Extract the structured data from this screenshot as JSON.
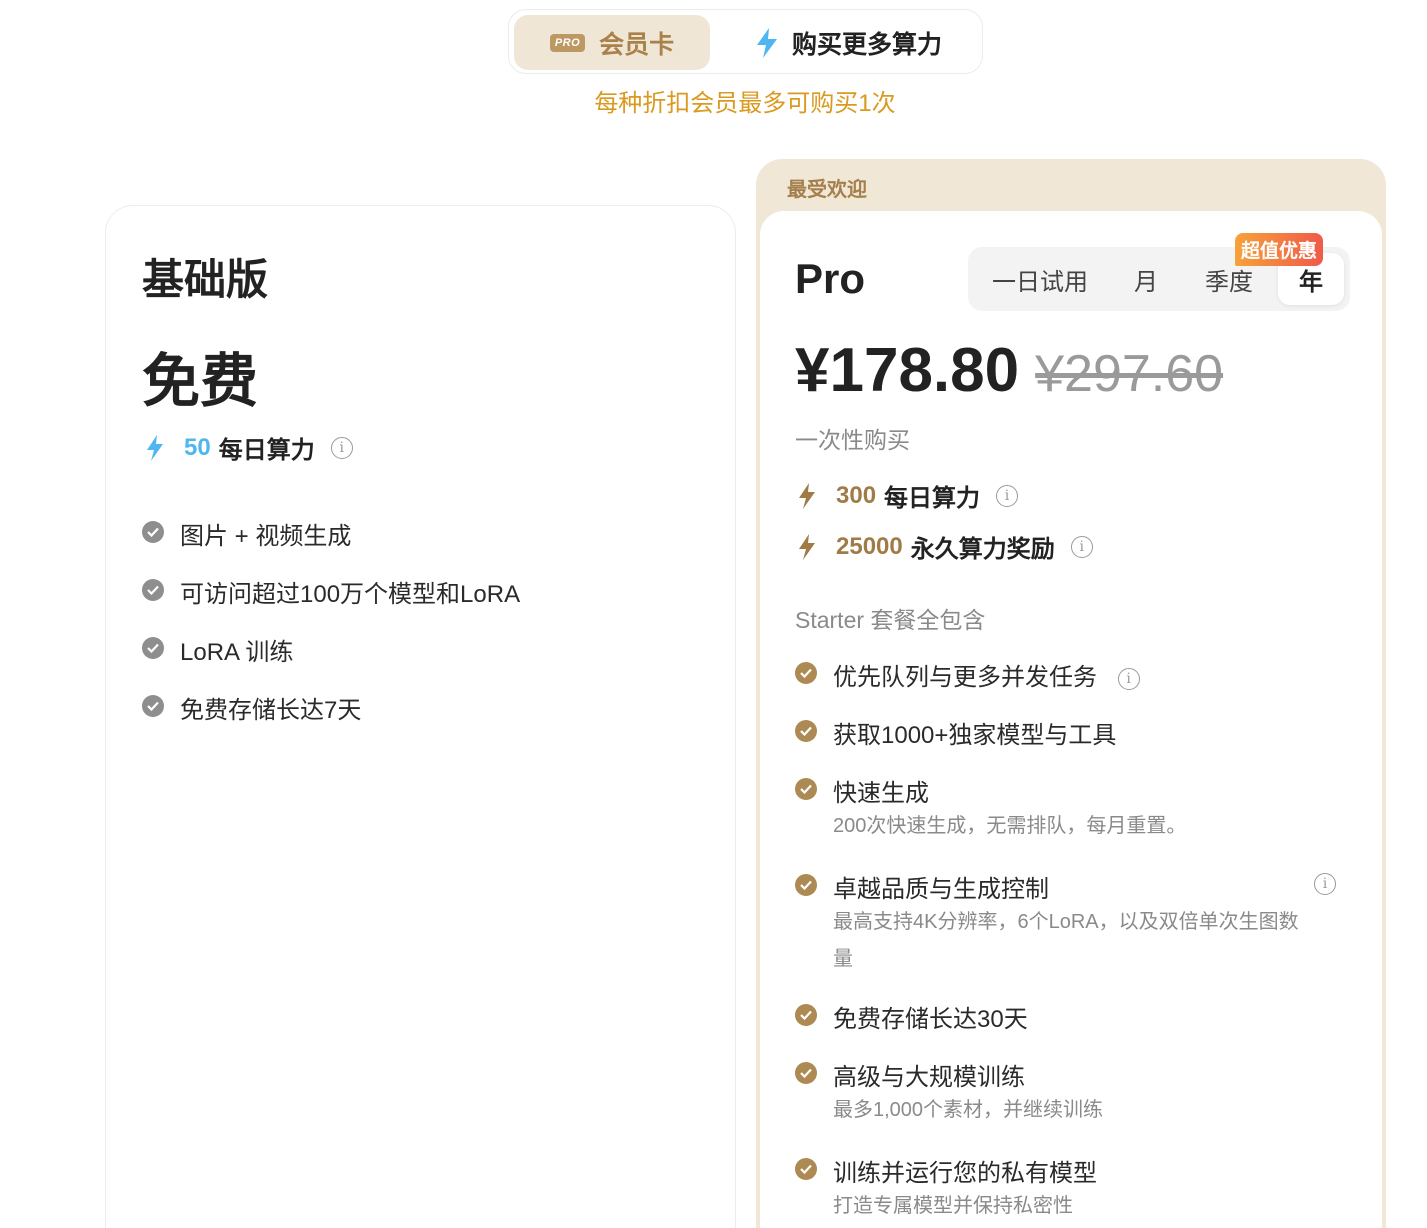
{
  "tabs": {
    "membership_badge": "PRO",
    "membership_label": "会员卡",
    "compute_label": "购买更多算力"
  },
  "notice": "每种折扣会员最多可购买1次",
  "basic": {
    "title": "基础版",
    "price": "免费",
    "credits_num": "50",
    "credits_label": "每日算力",
    "features": [
      "图片 + 视频生成",
      "可访问超过100万个模型和LoRA",
      "LoRA 训练",
      "免费存储长达7天"
    ]
  },
  "pro": {
    "ribbon": "最受欢迎",
    "title": "Pro",
    "periods": [
      "一日试用",
      "月",
      "季度",
      "年"
    ],
    "selected_period": "年",
    "deal_badge": "超值优惠",
    "price_now": "¥178.80",
    "price_old": "¥297.60",
    "payment_type": "一次性购买",
    "daily_credits_num": "300",
    "daily_credits_label": "每日算力",
    "bonus_credits_num": "25000",
    "bonus_credits_label": "永久算力奖励",
    "includes": "Starter 套餐全包含",
    "features": [
      {
        "title": "优先队列与更多并发任务",
        "desc": ""
      },
      {
        "title": "获取1000+独家模型与工具",
        "desc": ""
      },
      {
        "title": "快速生成",
        "desc": "200次快速生成，无需排队，每月重置。"
      },
      {
        "title": "卓越品质与生成控制",
        "desc": "最高支持4K分辨率，6个LoRA，以及双倍单次生图数量"
      },
      {
        "title": "免费存储长达30天",
        "desc": ""
      },
      {
        "title": "高级与大规模训练",
        "desc": "最多1,000个素材，并继续训练"
      },
      {
        "title": "训练并运行您的私有模型",
        "desc": "打造专属模型并保持私密性"
      }
    ]
  },
  "colors": {
    "gold": "#ad8a53",
    "notice_orange": "#d99a1f",
    "bolt_blue": "#4fb6f0",
    "tab_bg": "#f0e6d6"
  }
}
